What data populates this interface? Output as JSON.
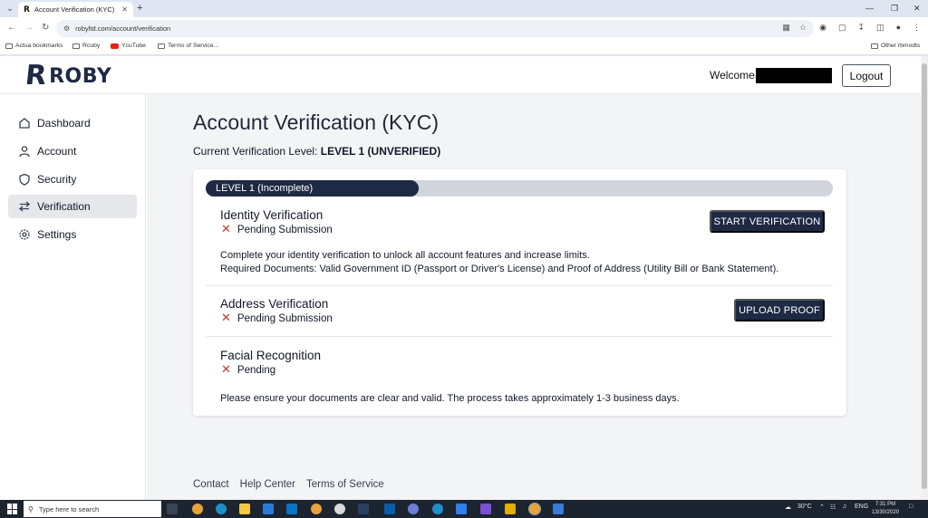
{
  "browser": {
    "tab_title": "Account Verification (KYC)",
    "tab_favicon": "R",
    "url": "robyltd.com/account/verification",
    "bookmarks": [
      "Actua bookmarks",
      "Rcoby",
      "YcuTube",
      "Terms of Service..."
    ],
    "other_bookmarks": "Other rbmodts"
  },
  "header": {
    "logo_mark": "R",
    "logo_text": "ROBY",
    "welcome": "Welcome,",
    "logout_label": "Logout"
  },
  "sidebar": {
    "items": [
      {
        "label": "Dashboard",
        "icon": "dashboard-icon"
      },
      {
        "label": "Account",
        "icon": "user-icon"
      },
      {
        "label": "Security",
        "icon": "shield-icon"
      },
      {
        "label": "Verification",
        "icon": "exchange-icon",
        "active": true
      },
      {
        "label": "Settings",
        "icon": "gear-icon"
      }
    ]
  },
  "main": {
    "title": "Account Verification (KYC)",
    "level_prefix": "Current Verification Level:",
    "level_value": "LEVEL 1 (UNVERIFIED)",
    "progress_label": "LEVEL 1 (Incomplete)",
    "progress_fraction": 0.34,
    "sections": {
      "identity": {
        "title": "Identity Verification",
        "status": "Pending Submission",
        "button": "START VERIFICATION",
        "desc_line1": "Complete your identity verification to unlock all account features and increase limits.",
        "desc_line2": "Required Documents: Valid Government ID (Passport or Driver's License) and Proof of Address (Utility Bill or Bank Statement)."
      },
      "address": {
        "title": "Address Verification",
        "status": "Pending Submission",
        "button": "UPLOAD PROOF"
      },
      "facial": {
        "title": "Facial Recognition",
        "status": "Pending"
      }
    },
    "note": "Please ensure your documents are clear and valid. The process takes approximately 1-3 business days."
  },
  "footer": {
    "links": [
      "Contact",
      "Help Center",
      "Terms of Service"
    ]
  },
  "taskbar": {
    "search_placeholder": "Type here to search",
    "weather": "30°C",
    "lang": "ENG",
    "time": "7:31 PM",
    "date": "13/30/2020"
  },
  "colors": {
    "brand": "#1e2a44",
    "status_x": "#c0392b",
    "page_bg": "#f3f4f6"
  }
}
